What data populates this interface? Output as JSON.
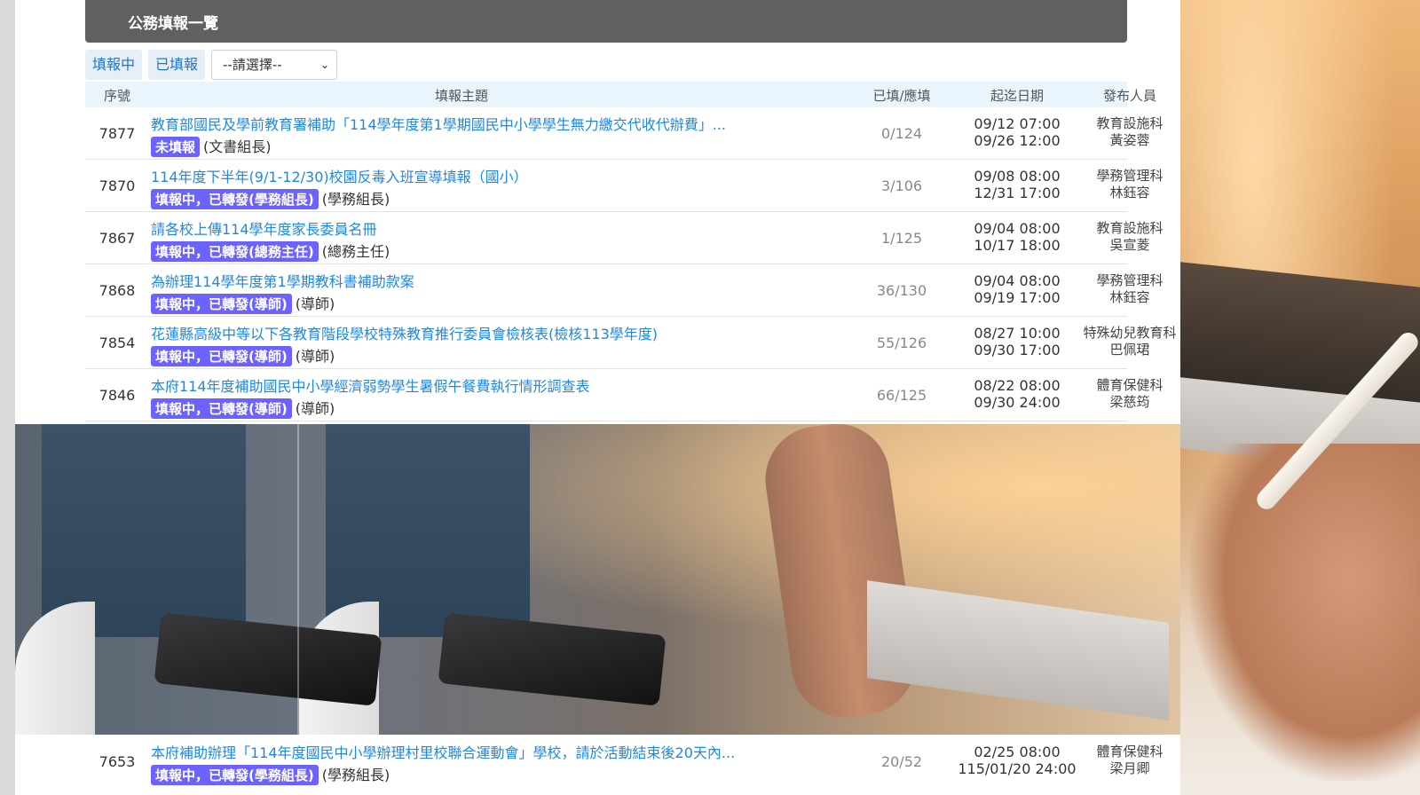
{
  "header": {
    "title": "公務填報一覽"
  },
  "tabs": [
    {
      "label": "填報中"
    },
    {
      "label": "已填報"
    }
  ],
  "filter": {
    "selected": "--請選擇--"
  },
  "table": {
    "columns": [
      "序號",
      "填報主題",
      "已填/應填",
      "起迄日期",
      "發布人員"
    ],
    "rows": [
      {
        "id": "7877",
        "title": "教育部國民及學前教育署補助「114學年度第1學期國民中小學學生無力繳交代收代辦費」...",
        "badge": "未填報",
        "role": "(文書組長)",
        "count": "0/124",
        "start": "09/12 07:00",
        "end": "09/26 12:00",
        "dept": "教育設施科",
        "person": "黃姿蓉"
      },
      {
        "id": "7870",
        "title": "114年度下半年(9/1-12/30)校園反毒入班宣導填報（國小）",
        "badge": "填報中，已轉發(學務組長)",
        "role": "(學務組長)",
        "count": "3/106",
        "start": "09/08 08:00",
        "end": "12/31 17:00",
        "dept": "學務管理科",
        "person": "林鈺容"
      },
      {
        "id": "7867",
        "title": "請各校上傳114學年度家長委員名冊",
        "badge": "填報中，已轉發(總務主任)",
        "role": "(總務主任)",
        "count": "1/125",
        "start": "09/04 08:00",
        "end": "10/17 18:00",
        "dept": "教育設施科",
        "person": "吳宣菱"
      },
      {
        "id": "7868",
        "title": "為辦理114學年度第1學期教科書補助款案",
        "badge": "填報中，已轉發(導師)",
        "role": "(導師)",
        "count": "36/130",
        "start": "09/04 08:00",
        "end": "09/19 17:00",
        "dept": "學務管理科",
        "person": "林鈺容"
      },
      {
        "id": "7854",
        "title": "花蓮縣高級中等以下各教育階段學校特殊教育推行委員會檢核表(檢核113學年度)",
        "badge": "填報中，已轉發(導師)",
        "role": "(導師)",
        "count": "55/126",
        "start": "08/27 10:00",
        "end": "09/30 17:00",
        "dept": "特殊幼兒教育科",
        "person": "巴佩珺"
      },
      {
        "id": "7846",
        "title": "本府114年度補助國民中小學經濟弱勢學生暑假午餐費執行情形調查表",
        "badge": "填報中，已轉發(導師)",
        "role": "(導師)",
        "count": "66/125",
        "start": "08/22 08:00",
        "end": "09/30 24:00",
        "dept": "體育保健科",
        "person": "梁慈筠"
      },
      {
        "id": "7653",
        "title": "本府補助辦理「114年度國民中小學辦理村里校聯合運動會」學校，請於活動結束後20天內...",
        "badge": "填報中，已轉發(學務組長)",
        "role": "(學務組長)",
        "count": "20/52",
        "start": "02/25 08:00",
        "end": "115/01/20 24:00",
        "dept": "體育保健科",
        "person": "梁月卿"
      }
    ]
  }
}
